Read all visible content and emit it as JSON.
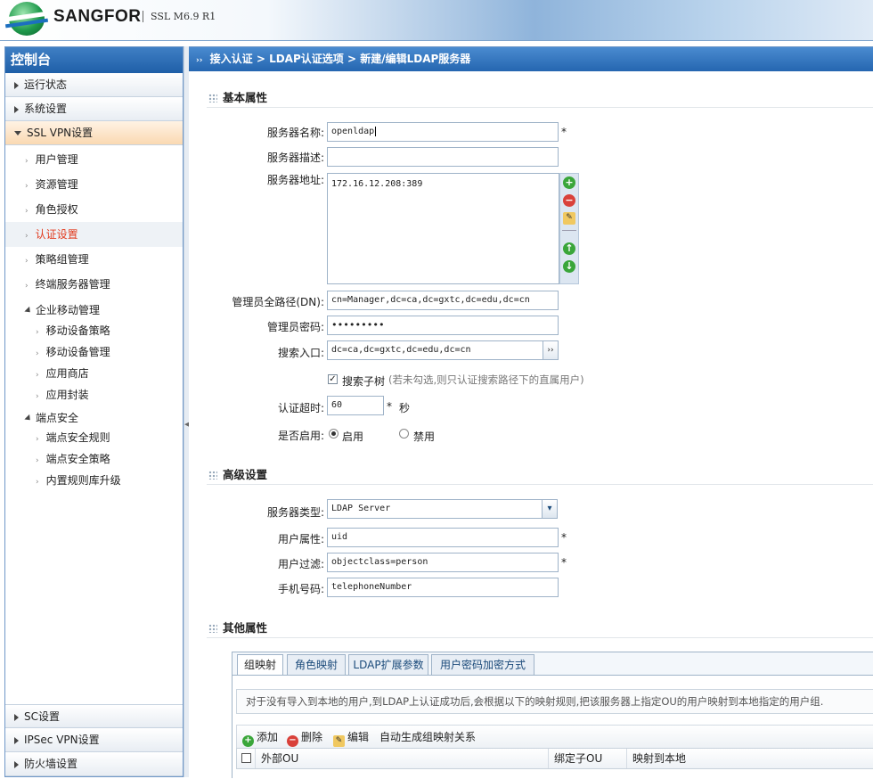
{
  "header": {
    "brand": "SANGFOR",
    "version": "SSL M6.9 R1"
  },
  "sidebar": {
    "title": "控制台",
    "sections": [
      {
        "label": "运行状态"
      },
      {
        "label": "系统设置"
      },
      {
        "label": "SSL VPN设置"
      }
    ],
    "items": [
      {
        "label": "用户管理"
      },
      {
        "label": "资源管理"
      },
      {
        "label": "角色授权"
      },
      {
        "label": "认证设置"
      },
      {
        "label": "策略组管理"
      },
      {
        "label": "终端服务器管理"
      }
    ],
    "group1": {
      "label": "企业移动管理",
      "items": [
        {
          "label": "移动设备策略"
        },
        {
          "label": "移动设备管理"
        },
        {
          "label": "应用商店"
        },
        {
          "label": "应用封装"
        }
      ]
    },
    "group2": {
      "label": "端点安全",
      "items": [
        {
          "label": "端点安全规则"
        },
        {
          "label": "端点安全策略"
        },
        {
          "label": "内置规则库升级"
        }
      ]
    },
    "bottom": [
      {
        "label": "SC设置"
      },
      {
        "label": "IPSec VPN设置"
      },
      {
        "label": "防火墙设置"
      }
    ]
  },
  "breadcrumb": {
    "items": [
      "接入认证",
      "LDAP认证选项",
      "新建/编辑LDAP服务器"
    ],
    "sep": ">"
  },
  "basic": {
    "title": "基本属性",
    "name_label": "服务器名称:",
    "name_value": "openldap",
    "desc_label": "服务器描述:",
    "desc_value": "",
    "addr_label": "服务器地址:",
    "addr_value": "172.16.12.208:389",
    "dn_label": "管理员全路径(DN):",
    "dn_value": "cn=Manager,dc=ca,dc=gxtc,dc=edu,dc=cn",
    "pwd_label": "管理员密码:",
    "pwd_value": "•••••••••",
    "search_label": "搜索入口:",
    "search_value": "dc=ca,dc=gxtc,dc=edu,dc=cn",
    "subtree_label": "搜索子树",
    "subtree_hint": "(若未勾选,则只认证搜索路径下的直属用户)",
    "timeout_label": "认证超时:",
    "timeout_value": "60",
    "timeout_unit": "秒",
    "enable_label": "是否启用:",
    "enable_on": "启用",
    "enable_off": "禁用",
    "required": "*"
  },
  "advanced": {
    "title": "高级设置",
    "type_label": "服务器类型:",
    "type_value": "LDAP Server",
    "attr_label": "用户属性:",
    "attr_value": "uid",
    "filter_label": "用户过滤:",
    "filter_value": "objectclass=person",
    "phone_label": "手机号码:",
    "phone_value": "telephoneNumber"
  },
  "other": {
    "title": "其他属性",
    "tabs": [
      {
        "label": "组映射"
      },
      {
        "label": "角色映射"
      },
      {
        "label": "LDAP扩展参数"
      },
      {
        "label": "用户密码加密方式"
      }
    ],
    "note": "对于没有导入到本地的用户,到LDAP上认证成功后,会根据以下的映射规则,把该服务器上指定OU的用户映射到本地指定的用户组.",
    "toolbar": {
      "add": "添加",
      "delete": "删除",
      "edit": "编辑",
      "auto": "自动生成组映射关系"
    },
    "columns": [
      "外部OU",
      "绑定子OU",
      "映射到本地"
    ]
  }
}
